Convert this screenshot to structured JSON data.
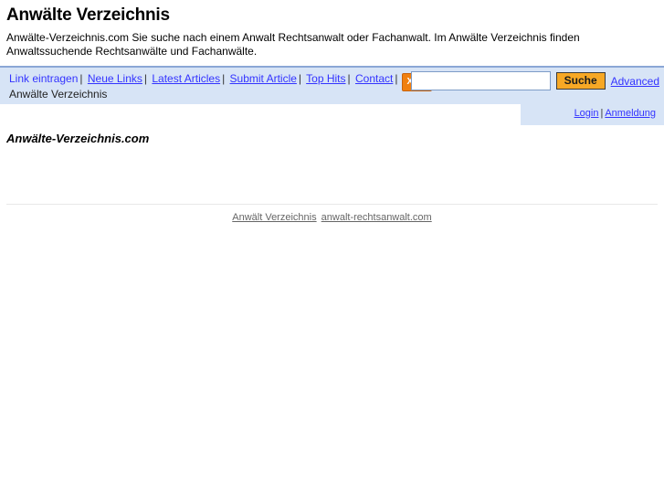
{
  "header": {
    "title": "Anwälte Verzeichnis",
    "description": "Anwälte-Verzeichnis.com Sie suche nach einem Anwalt Rechtsanwalt oder Fachanwalt. Im Anwälte Verzeichnis finden Anwaltssuchende Rechtsanwälte und Fachanwälte."
  },
  "nav": {
    "items": [
      {
        "label": "Link eintragen",
        "current": true
      },
      {
        "label": "Neue Links",
        "current": false
      },
      {
        "label": "Latest Articles",
        "current": false
      },
      {
        "label": "Submit Article",
        "current": false
      },
      {
        "label": "Top Hits",
        "current": false
      },
      {
        "label": "Contact",
        "current": false
      }
    ],
    "separator": "|",
    "xml_badge": "XML",
    "breadcrumb": "Anwälte Verzeichnis"
  },
  "search": {
    "value": "",
    "placeholder": "",
    "button_label": "Suche",
    "advanced_label": "Advanced"
  },
  "account": {
    "login_label": "Login",
    "separator": "|",
    "register_label": "Anmeldung"
  },
  "main": {
    "domain_heading": "Anwälte-Verzeichnis.com"
  },
  "footer": {
    "links": [
      {
        "label": "Anwält Verzeichnis"
      },
      {
        "label": "anwalt-rechtsanwalt.com"
      }
    ]
  },
  "colors": {
    "band_blue": "#d7e4f6",
    "band_border": "#8ba7d6",
    "link_blue": "#3333ff",
    "xml_orange": "#f08010",
    "button_orange": "#f7a825",
    "footer_link_gray": "#666666"
  }
}
